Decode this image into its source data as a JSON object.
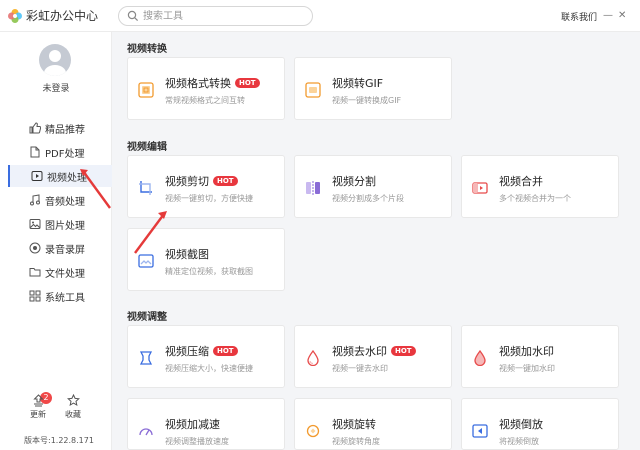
{
  "app": {
    "title": "彩虹办公中心",
    "search_placeholder": "搜索工具",
    "contact": "联系我们"
  },
  "user": {
    "login_label": "未登录"
  },
  "sidebar": {
    "items": [
      {
        "label": "精品推荐",
        "icon": "thumbs-up-icon"
      },
      {
        "label": "PDF处理",
        "icon": "document-icon"
      },
      {
        "label": "视频处理",
        "icon": "video-icon",
        "active": true
      },
      {
        "label": "音频处理",
        "icon": "music-icon"
      },
      {
        "label": "图片处理",
        "icon": "image-icon"
      },
      {
        "label": "录音录屏",
        "icon": "record-icon"
      },
      {
        "label": "文件处理",
        "icon": "folder-icon"
      },
      {
        "label": "系统工具",
        "icon": "grid-icon"
      }
    ],
    "update_label": "更新",
    "update_badge": "2",
    "favorite_label": "收藏",
    "version": "版本号:1.22.8.171"
  },
  "sections": [
    {
      "title": "视频转换",
      "cards": [
        {
          "title": "视频格式转换",
          "hot": "HOT",
          "desc": "常规视频格式之间互转"
        },
        {
          "title": "视频转GIF",
          "desc": "视频一键转换成GIF"
        }
      ]
    },
    {
      "title": "视频编辑",
      "cards": [
        {
          "title": "视频剪切",
          "hot": "HOT",
          "desc": "视频一键剪切，方便快捷"
        },
        {
          "title": "视频分割",
          "desc": "视频分割成多个片段"
        },
        {
          "title": "视频合并",
          "desc": "多个视频合并为一个"
        },
        {
          "title": "视频截图",
          "desc": "精准定位视频，获取截图"
        }
      ]
    },
    {
      "title": "视频调整",
      "cards": [
        {
          "title": "视频压缩",
          "hot": "HOT",
          "desc": "视频压缩大小，快速便捷"
        },
        {
          "title": "视频去水印",
          "hot": "HOT",
          "desc": "视频一键去水印"
        },
        {
          "title": "视频加水印",
          "desc": "视频一键加水印"
        },
        {
          "title": "视频加减速",
          "desc": "视频调整播放速度"
        },
        {
          "title": "视频旋转",
          "desc": "视频旋转角度"
        },
        {
          "title": "视频倒放",
          "desc": "将视频倒放"
        }
      ]
    }
  ],
  "colors": {
    "accent": "#3a6de0",
    "hot": "#e8373e",
    "orange": "#f29a2e",
    "purple": "#8a6cd6",
    "red": "#e74b4b",
    "annotation": "#e53a3a"
  }
}
